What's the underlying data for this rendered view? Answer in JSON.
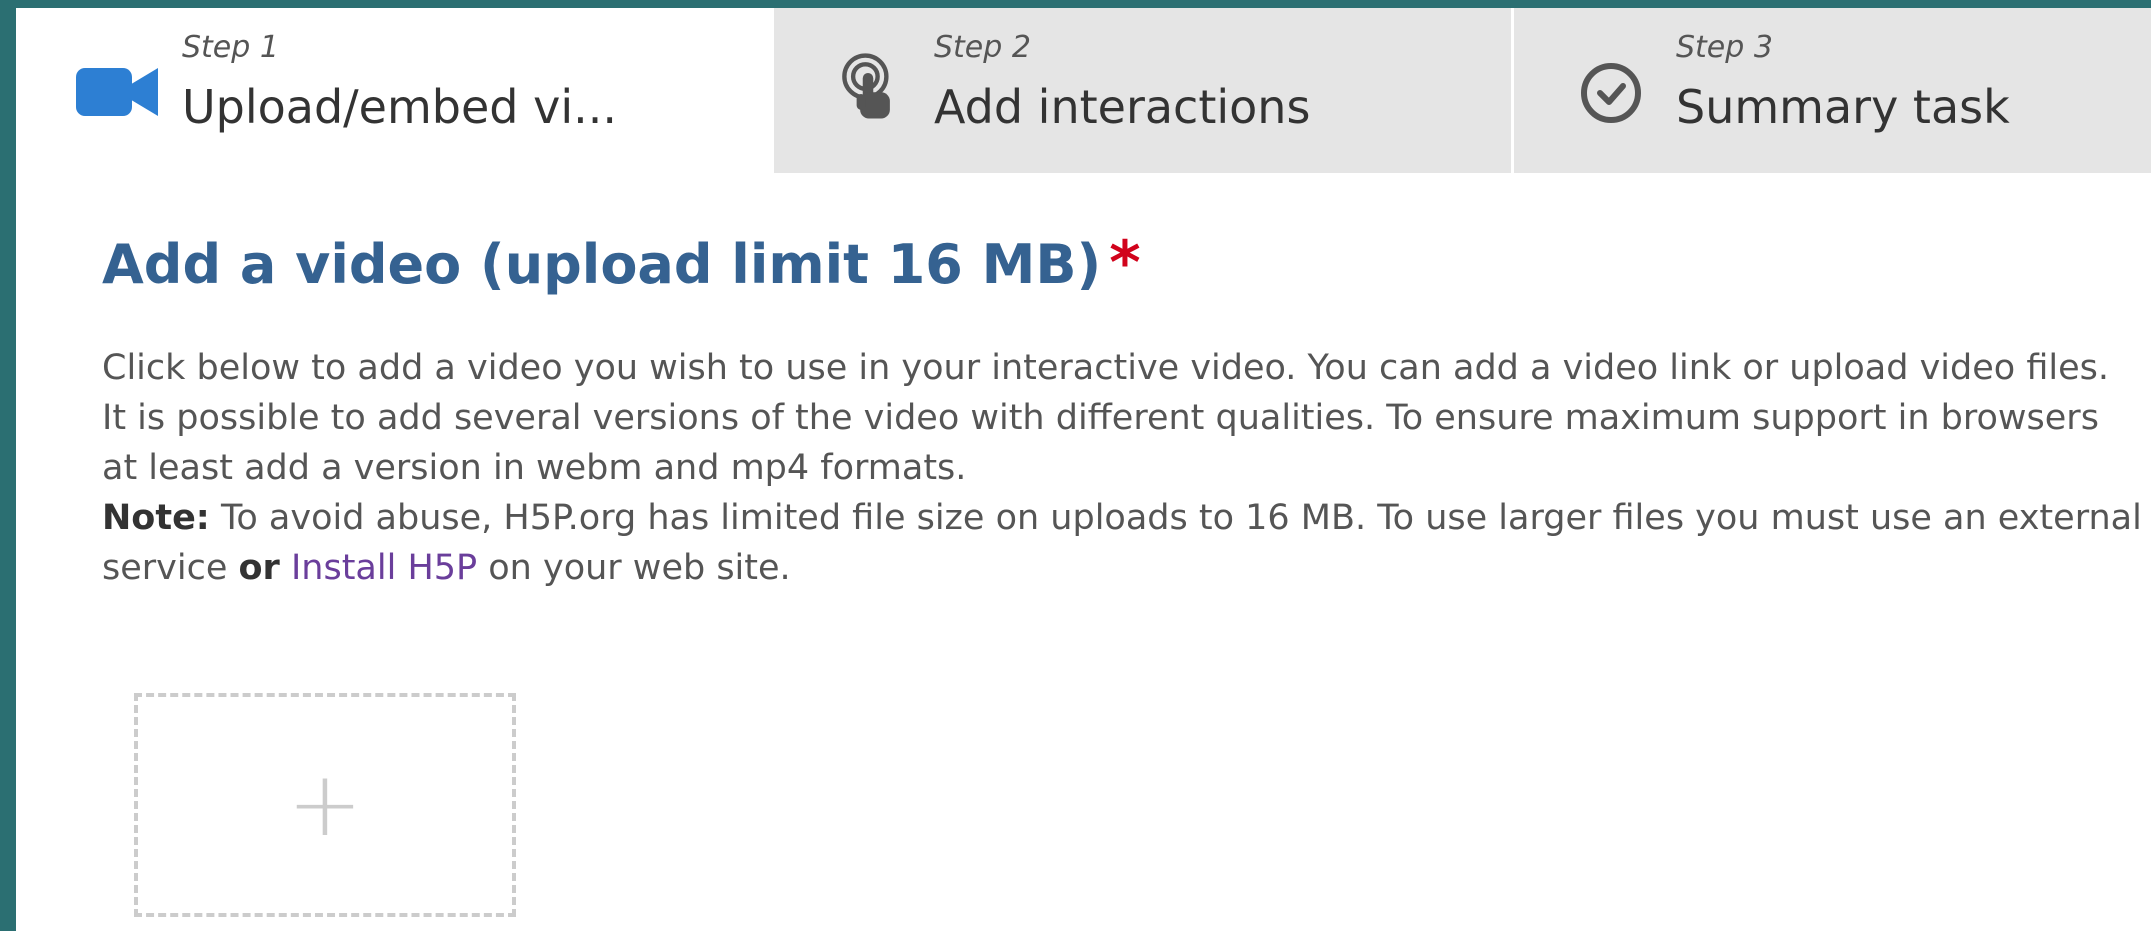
{
  "tabs": [
    {
      "step": "Step 1",
      "title": "Upload/embed vi...",
      "icon": "video-camera-icon",
      "active": true
    },
    {
      "step": "Step 2",
      "title": "Add interactions",
      "icon": "touch-hand-icon",
      "active": false
    },
    {
      "step": "Step 3",
      "title": "Summary task",
      "icon": "check-circle-icon",
      "active": false
    }
  ],
  "section": {
    "heading": "Add a video (upload limit 16 MB)",
    "required_mark": "*",
    "description": "Click below to add a video you wish to use in your interactive video. You can add a video link or upload video files. It is possible to add several versions of the video with different qualities. To ensure maximum support in browsers at least add a version in webm and mp4 formats.",
    "note_label": "Note:",
    "note_text_1": " To avoid abuse, H5P.org has limited file size on uploads to 16 MB. To use larger files you must use an external service ",
    "note_or": "or",
    "note_link": "Install H5P",
    "note_text_2": " on your web site."
  },
  "upload": {
    "add_symbol": "+"
  },
  "colors": {
    "accent_blue": "#2d7fd3",
    "heading_blue": "#356291",
    "required_red": "#d1021b",
    "link_purple": "#6a3e9b",
    "inactive_tab": "#e5e5e5",
    "outer_background": "#2b6f72"
  }
}
